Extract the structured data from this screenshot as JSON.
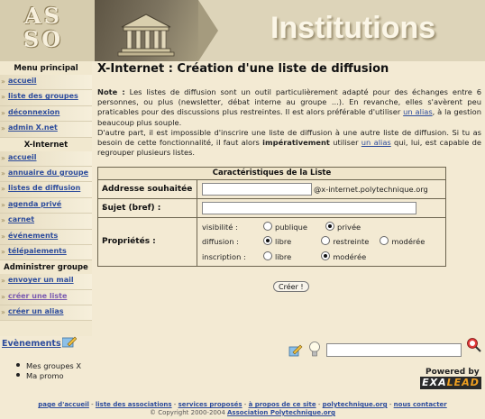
{
  "banner": {
    "logo": "AS\nSO",
    "title": "Institutions"
  },
  "sidebar": {
    "menu_principal": {
      "heading": "Menu principal",
      "items": [
        "accueil",
        "liste des groupes",
        "déconnexion",
        "admin X.net"
      ]
    },
    "xinternet": {
      "heading": "X-Internet",
      "items": [
        "accueil",
        "annuaire du groupe",
        "listes de diffusion",
        "agenda privé",
        "carnet",
        "événements",
        "télépaiements"
      ]
    },
    "admin_groupe": {
      "heading": "Administrer groupe",
      "items": [
        "envoyer un mail",
        "créer une liste",
        "créer un alias"
      ]
    }
  },
  "main": {
    "title": "X-Internet : Création d'une liste de diffusion",
    "note": {
      "label": "Note :",
      "text1": " Les listes de diffusion sont un outil particulièrement adapté pour des échanges entre 6 personnes, ou plus (newsletter, débat interne au groupe ...). En revanche, elles s'avèrent peu praticables pour des discussions plus restreintes. Il est alors préférable d'utiliser ",
      "link1": "un alias",
      "text2": ", à la gestion beaucoup plus souple.",
      "text3": "D'autre part, il est impossible d'inscrire une liste de diffusion à une autre liste de diffusion. Si tu as besoin de cette fonctionnalité, il faut alors ",
      "strong": "impérativement",
      "text4": " utiliser ",
      "link2": "un alias",
      "text5": " qui, lui, est capable de regrouper plusieurs listes."
    },
    "form": {
      "heading": "Caractéristiques de la Liste",
      "address_label": "Addresse souhaitée :",
      "address_value": "",
      "address_suffix": "@x-internet.polytechnique.org",
      "subject_label": "Sujet (bref) :",
      "subject_value": "",
      "properties_label": "Propriétés :",
      "visibility": {
        "label": "visibilité :",
        "opt1": "publique",
        "opt2": "privée",
        "selected": "privée"
      },
      "diffusion": {
        "label": "diffusion :",
        "opt1": "libre",
        "opt2": "restreinte",
        "opt3": "modérée",
        "selected": "libre"
      },
      "inscription": {
        "label": "inscription :",
        "opt1": "libre",
        "opt2": "modérée",
        "selected": "modérée"
      },
      "submit": "Créer !"
    }
  },
  "events": {
    "title": "Evènements",
    "items": [
      "Mes groupes X",
      "Ma promo"
    ]
  },
  "search": {
    "value": ""
  },
  "powered": {
    "label": "Powered by",
    "brand_a": "EXA",
    "brand_b": "LEAD"
  },
  "footer": {
    "links": [
      "page d'accueil",
      "liste des associations",
      "services proposés",
      "à propos de ce site",
      "polytechnique.org",
      "nous contacter"
    ],
    "copyright": "© Copyright 2000-2004 ",
    "copyright_link": "Association Polytechnique.org"
  }
}
